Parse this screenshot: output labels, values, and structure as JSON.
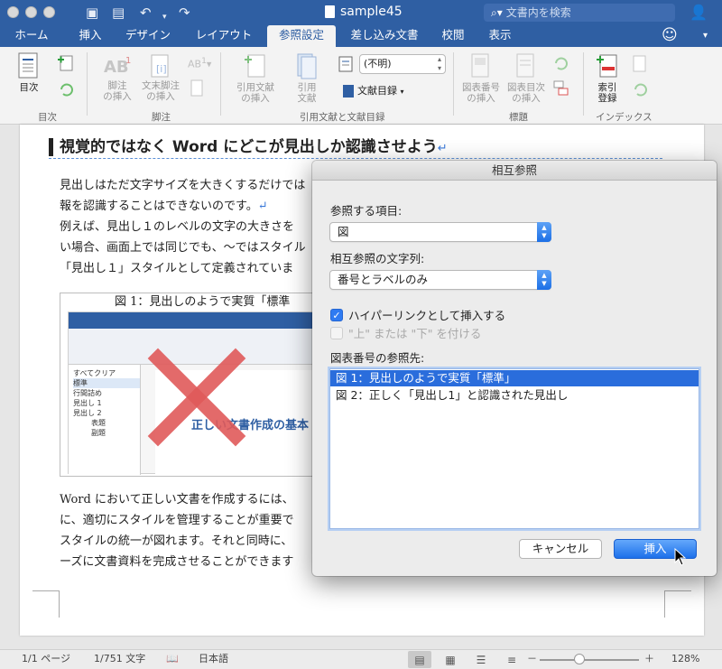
{
  "window": {
    "title": "sample45",
    "search_placeholder": "文書内を検索"
  },
  "tabs": [
    "ホーム",
    "挿入",
    "デザイン",
    "レイアウト",
    "参照設定",
    "差し込み文書",
    "校閲",
    "表示"
  ],
  "active_tab": "参照設定",
  "ribbon": {
    "toc": {
      "label": "目次",
      "group": "目次"
    },
    "footnotes": {
      "insert_footnote": "脚注\nの挿入",
      "insert_endnote": "文末脚注\nの挿入",
      "group": "脚注"
    },
    "citations": {
      "insert_citation": "引用文献\nの挿入",
      "citation": "引用\n文献",
      "style_value": "(不明)",
      "bibliography": "文献目録",
      "group": "引用文献と文献目録"
    },
    "captions": {
      "insert_caption": "図表番号\nの挿入",
      "insert_table_of_figures": "図表目次\nの挿入",
      "group": "標題"
    },
    "index": {
      "mark_entry": "索引\n登録",
      "group": "インデックス"
    }
  },
  "document": {
    "heading": "視覚的ではなく Word にどこが見出しか認識させよう",
    "lines_top": [
      "見出しはただ文字サイズを大きくするだけでは",
      "報を認識することはできないのです。",
      "例えば、見出し１のレベルの文字の大きさを",
      "い場合、画面上では同じでも、～ではスタイル",
      "「見出し１」スタイルとして定義されていま"
    ],
    "figure_caption": "図 1：見出しのようで実質「標準",
    "figure": {
      "doc_title": "正しい文書作成の基本",
      "pane_items": [
        "すべてクリア",
        "標準",
        "行間詰め",
        "見出し 1",
        "見出し 2",
        "表題",
        "副題"
      ]
    },
    "lines_bottom": [
      "Word において正しい文書を作成するには、",
      "に、適切にスタイルを管理することが重要で",
      "スタイルの統一が図れます。それと同時に、",
      "ーズに文書資料を完成させることができます"
    ]
  },
  "statusbar": {
    "page": "1/1 ページ",
    "words": "1/751 文字",
    "language": "日本語",
    "zoom": "128%",
    "zoom_minus": "－",
    "zoom_plus": "＋"
  },
  "dialog": {
    "title": "相互参照",
    "ref_type_label": "参照する項目:",
    "ref_type_value": "図",
    "ref_text_label": "相互参照の文字列:",
    "ref_text_value": "番号とラベルのみ",
    "hyperlink_label": "ハイパーリンクとして挿入する",
    "hyperlink_checked": true,
    "above_below_label": "\"上\" または \"下\" を付ける",
    "above_below_checked": false,
    "list_label": "図表番号の参照先:",
    "items": [
      "図 1：見出しのようで実質「標準」",
      "図 2：正しく「見出し1」と認識された見出し"
    ],
    "selected_index": 0,
    "cancel_label": "キャンセル",
    "insert_label": "挿入"
  },
  "colors": {
    "accent": "#2f5fa3",
    "selection": "#2a6ddc",
    "cross": "#e05a5a"
  }
}
